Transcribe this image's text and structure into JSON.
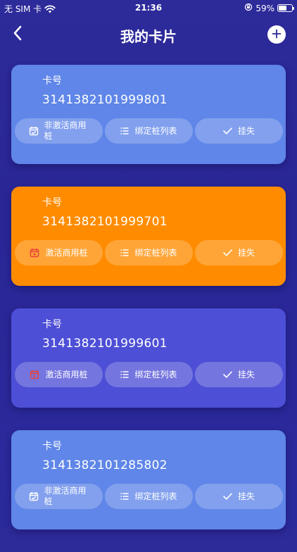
{
  "status_bar": {
    "carrier": "无 SIM 卡",
    "time": "21:36",
    "battery": "59%",
    "battery_level": 0.59
  },
  "nav": {
    "title": "我的卡片"
  },
  "cards": [
    {
      "label": "卡号",
      "number": "3141382101999801",
      "color": "#5f86e8",
      "actions": [
        "非激活商用桩",
        "绑定桩列表",
        "挂失"
      ]
    },
    {
      "label": "卡号",
      "number": "3141382101999701",
      "color": "#ff8c00",
      "actions": [
        "激活商用桩",
        "绑定桩列表",
        "挂失"
      ]
    },
    {
      "label": "卡号",
      "number": "3141382101999601",
      "color": "#4d4fd6",
      "actions": [
        "激活商用桩",
        "绑定桩列表",
        "挂失"
      ]
    },
    {
      "label": "卡号",
      "number": "3141382101285802",
      "color": "#5f86e8",
      "actions": [
        "非激活商用桩",
        "绑定桩列表",
        "挂失"
      ]
    }
  ],
  "colors": {
    "activate_icon_red": "#e8413a",
    "background": "#2b2898"
  },
  "icons": {
    "inactive": "calendar-check-icon",
    "active": "calendar-icon",
    "bound_list": "list-icon",
    "report_loss": "check-icon"
  }
}
